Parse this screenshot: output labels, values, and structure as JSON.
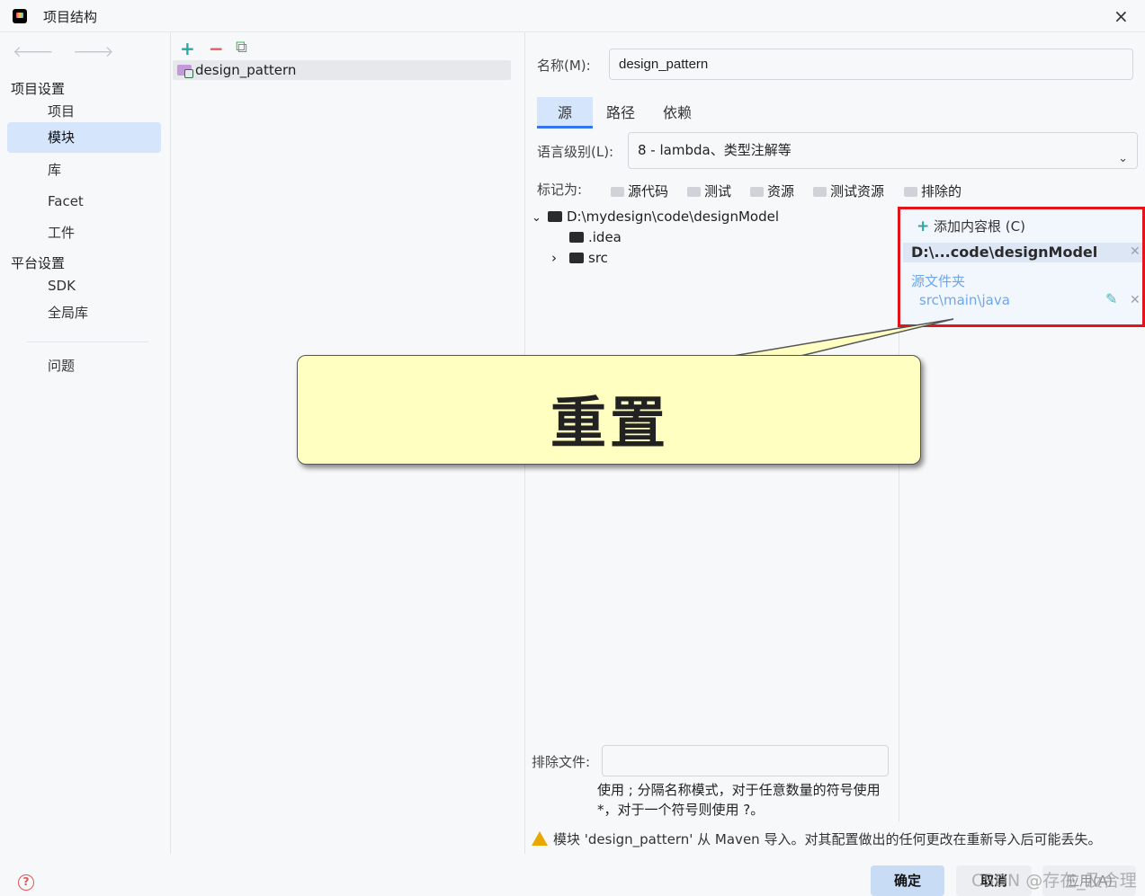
{
  "window": {
    "title": "项目结构",
    "close": "×"
  },
  "nav": {
    "back": "🡐",
    "forward": "🡒",
    "project_settings": "项目设置",
    "items_project": [
      "项目",
      "模块",
      "库",
      "Facet",
      "工件"
    ],
    "platform_settings": "平台设置",
    "items_platform": [
      "SDK",
      "全局库"
    ],
    "problems": "问题",
    "selected": "模块"
  },
  "module_list": {
    "add": "+",
    "remove": "−",
    "copy": "⧉",
    "modules": [
      "design_pattern"
    ]
  },
  "detail": {
    "name_label": "名称(M):",
    "name_value": "design_pattern",
    "tabs": [
      "源",
      "路径",
      "依赖"
    ],
    "selected_tab": "源",
    "lang_label": "语言级别(L):",
    "lang_value": "8 - lambda、类型注解等",
    "mark_as_label": "标记为:",
    "mark_as": [
      "源代码",
      "测试",
      "资源",
      "测试资源",
      "排除的"
    ],
    "tree": {
      "root": "D:\\mydesign\\code\\designModel",
      "children": [
        ".idea",
        "src"
      ]
    },
    "content_roots": {
      "add": "添加内容根 (C)",
      "root_path": "D:\\...code\\designModel",
      "source_folders_label": "源文件夹",
      "source_folder": "src\\main\\java"
    },
    "exclude_label": "排除文件:",
    "exclude_value": "",
    "exclude_hint": "使用 ; 分隔名称模式，对于任意数量的符号使用 *，对于一个符号则使用 ?。",
    "warning": "模块 'design_pattern' 从 Maven 导入。对其配置做出的任何更改在重新导入后可能丢失。"
  },
  "callout": {
    "text": "重置"
  },
  "footer": {
    "help": "?",
    "ok": "确定",
    "cancel": "取消",
    "apply": "应用(A)",
    "watermark": "CSDN @存在_及合理"
  },
  "colors": {
    "accent": "#3574f0",
    "selection": "#d5e5fb",
    "annotation_red": "#e3141b",
    "callout_bg": "#ffffc1"
  }
}
